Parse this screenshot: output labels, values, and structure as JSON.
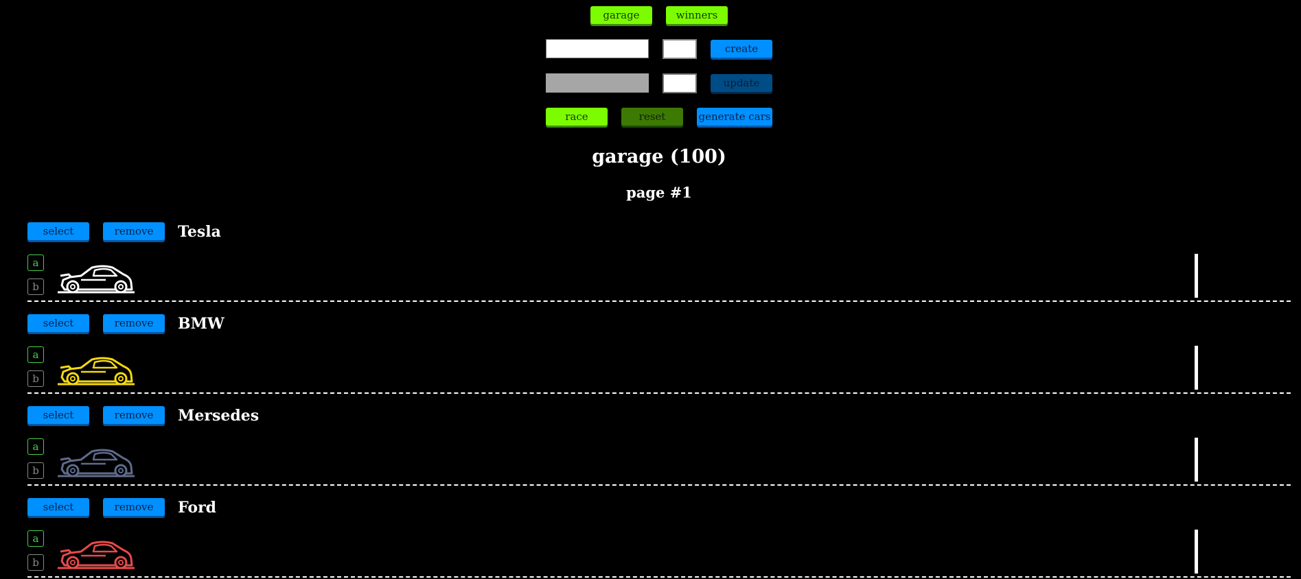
{
  "nav": {
    "garage_label": "garage",
    "winners_label": "winners"
  },
  "create": {
    "name_value": "",
    "button_label": "create"
  },
  "update": {
    "name_value": "",
    "button_label": "update"
  },
  "controls": {
    "race_label": "race",
    "reset_label": "reset",
    "generate_label": "generate cars"
  },
  "garage": {
    "title": "garage (100)",
    "page": "page #1"
  },
  "cars": [
    {
      "name": "Tesla",
      "color": "#ffffff",
      "select_label": "select",
      "remove_label": "remove",
      "start_label": "a",
      "stop_label": "b"
    },
    {
      "name": "BMW",
      "color": "#f5d90f",
      "select_label": "select",
      "remove_label": "remove",
      "start_label": "a",
      "stop_label": "b"
    },
    {
      "name": "Mersedes",
      "color": "#5f6b8c",
      "select_label": "select",
      "remove_label": "remove",
      "start_label": "a",
      "stop_label": "b"
    },
    {
      "name": "Ford",
      "color": "#e84a4a",
      "select_label": "select",
      "remove_label": "remove",
      "start_label": "a",
      "stop_label": "b"
    }
  ]
}
